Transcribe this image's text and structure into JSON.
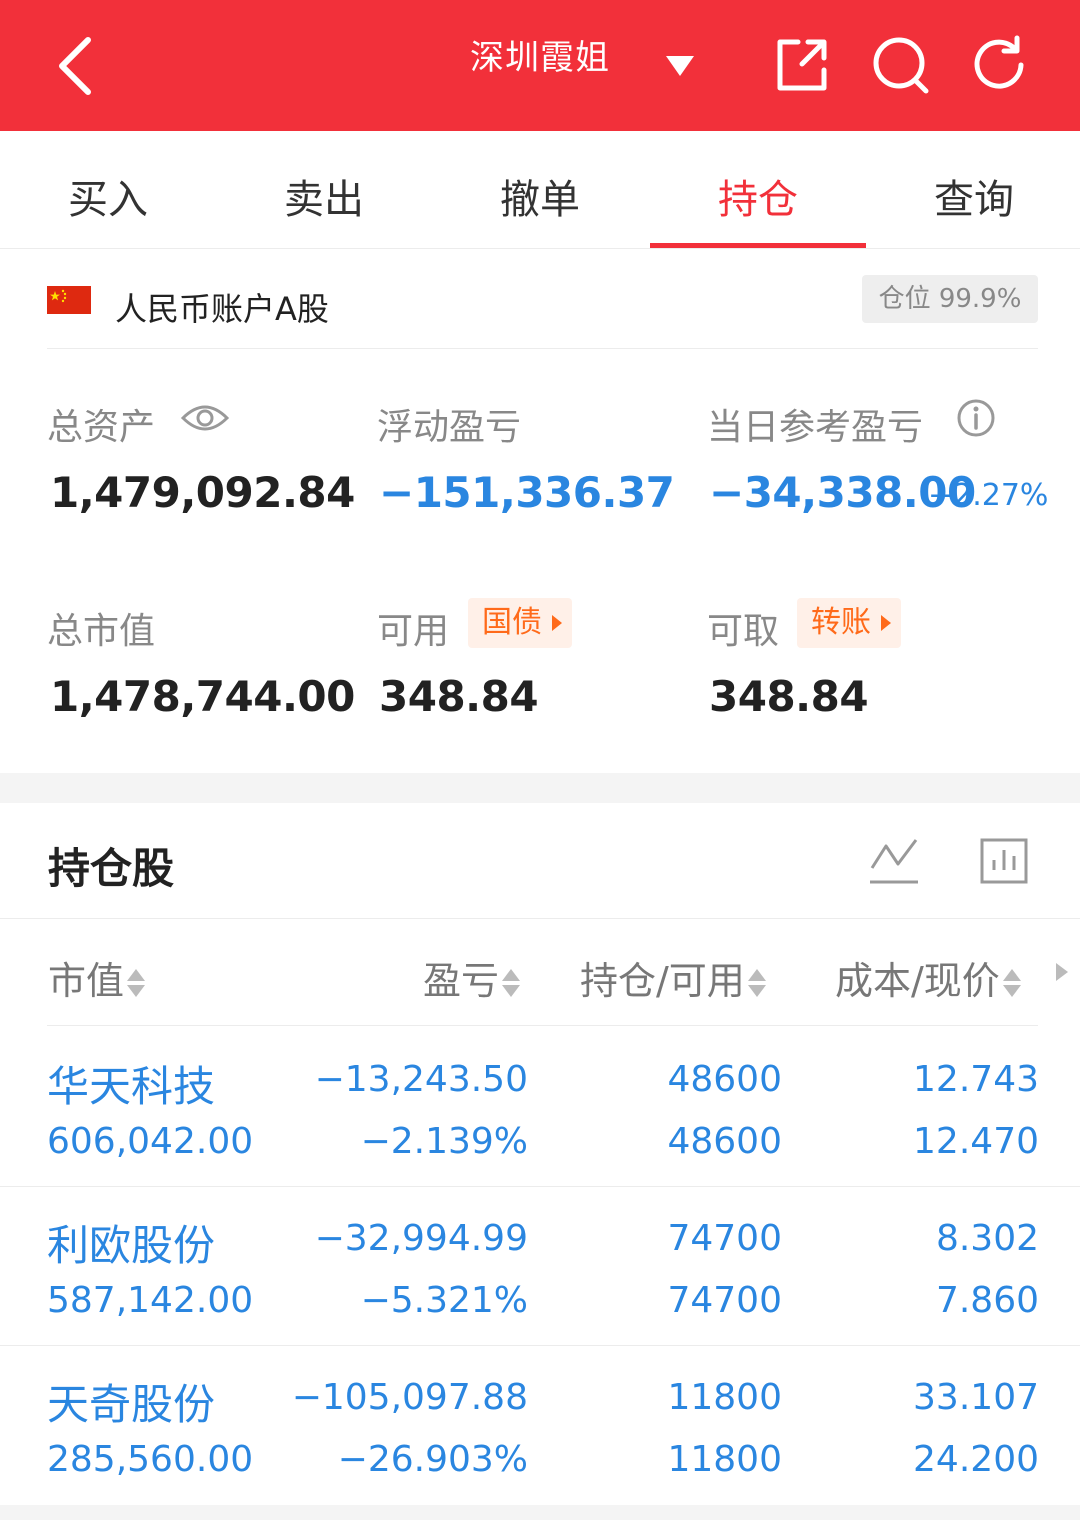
{
  "header": {
    "title": "深圳霞姐"
  },
  "tabs": [
    {
      "label": "买入"
    },
    {
      "label": "卖出"
    },
    {
      "label": "撤单"
    },
    {
      "label": "持仓",
      "active": true
    },
    {
      "label": "查询"
    }
  ],
  "account": {
    "name": "人民币账户A股",
    "position_badge": "仓位 99.9%"
  },
  "summary": {
    "total_assets_label": "总资产",
    "total_assets": "1,479,092.84",
    "floating_pl_label": "浮动盈亏",
    "floating_pl": "−151,336.37",
    "daily_pl_label": "当日参考盈亏",
    "daily_pl": "−34,338.00",
    "daily_pl_pct": "−2.27%",
    "market_value_label": "总市值",
    "market_value": "1,478,744.00",
    "available_label": "可用",
    "available_chip": "国债",
    "available": "348.84",
    "withdrawable_label": "可取",
    "withdrawable_chip": "转账",
    "withdrawable": "348.84"
  },
  "holdings": {
    "title": "持仓股",
    "columns": [
      "市值",
      "盈亏",
      "持仓/可用",
      "成本/现价"
    ],
    "rows": [
      {
        "name": "华天科技",
        "market_value": "606,042.00",
        "pl": "−13,243.50",
        "pl_pct": "−2.139%",
        "position": "48600",
        "available": "48600",
        "cost": "12.743",
        "price": "12.470"
      },
      {
        "name": "利欧股份",
        "market_value": "587,142.00",
        "pl": "−32,994.99",
        "pl_pct": "−5.321%",
        "position": "74700",
        "available": "74700",
        "cost": "8.302",
        "price": "7.860"
      },
      {
        "name": "天奇股份",
        "market_value": "285,560.00",
        "pl": "−105,097.88",
        "pl_pct": "−26.903%",
        "position": "11800",
        "available": "11800",
        "cost": "33.107",
        "price": "24.200"
      }
    ]
  },
  "colors": {
    "brand_red": "#f2303a",
    "loss_blue": "#2a86e0",
    "chip_orange": "#ff6a1a"
  },
  "icons": [
    "back-icon",
    "dropdown-caret-icon",
    "share-icon",
    "search-icon",
    "refresh-icon",
    "eye-icon",
    "info-icon",
    "line-chart-icon",
    "bar-chart-icon"
  ]
}
